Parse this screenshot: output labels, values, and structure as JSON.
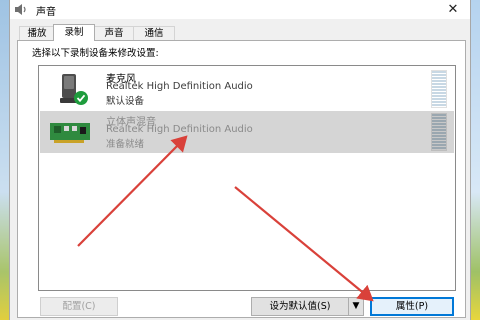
{
  "window": {
    "title": "声音",
    "close_glyph": "✕"
  },
  "tabs": [
    {
      "label": "播放",
      "active": false
    },
    {
      "label": "录制",
      "active": true
    },
    {
      "label": "声音",
      "active": false
    },
    {
      "label": "通信",
      "active": false
    }
  ],
  "instruction": "选择以下录制设备来修改设置:",
  "devices": [
    {
      "name": "麦克风",
      "driver": "Realtek High Definition Audio",
      "status": "默认设备",
      "icon": "microphone-icon",
      "badge": "default-check-icon",
      "selected": false
    },
    {
      "name": "立体声混音",
      "driver": "Realtek High Definition Audio",
      "status": "准备就绪",
      "icon": "sound-card-icon",
      "selected": true
    }
  ],
  "buttons": {
    "configure": "配置(C)",
    "set_default": "设为默认值(S)",
    "properties": "属性(P)"
  },
  "colors": {
    "accent": "#0078d7",
    "annotation_arrow": "#d9413a",
    "check_green": "#1e9c3d",
    "selection": "#d5d5d5"
  }
}
